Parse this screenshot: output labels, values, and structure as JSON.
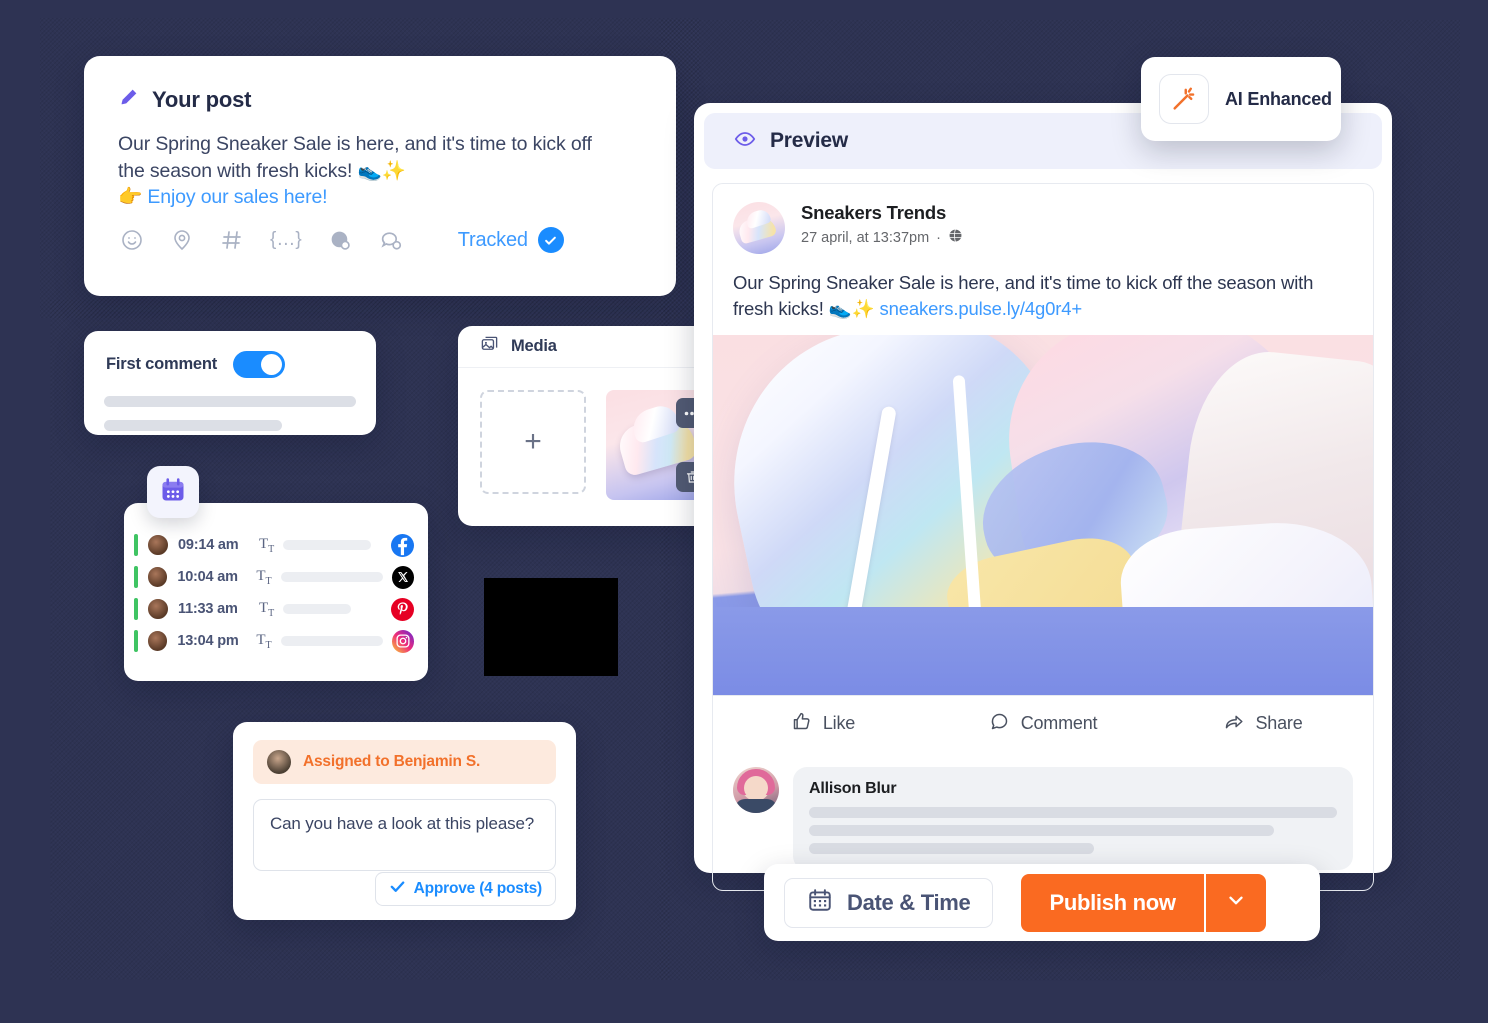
{
  "background_color": "#2e3353",
  "your_post": {
    "icon": "pencil-icon",
    "title": "Your post",
    "body_line1": "Our Spring Sneaker Sale is here, and it's time to kick off",
    "body_line2": "the season with fresh kicks! 👟✨",
    "link_line": "👉 Enjoy our sales here!",
    "tools": [
      {
        "name": "emoji-icon",
        "glyph": "emoji"
      },
      {
        "name": "location-icon",
        "glyph": "pin"
      },
      {
        "name": "hashtag-icon",
        "glyph": "#"
      },
      {
        "name": "variable-icon",
        "glyph": "{...}"
      },
      {
        "name": "globe-settings-icon",
        "glyph": "globe"
      },
      {
        "name": "chat-settings-icon",
        "glyph": "chat"
      }
    ],
    "tracked_label": "Tracked",
    "tracked_checked": true,
    "accent_blue": "#1a8cff"
  },
  "first_comment": {
    "label": "First comment",
    "toggle_on": true
  },
  "media": {
    "icon": "images-icon",
    "title": "Media",
    "add_label": "+",
    "thumb_more_icon": "more-dots-icon",
    "thumb_delete_icon": "trash-icon"
  },
  "schedule": {
    "badge_icon": "calendar-icon",
    "rows": [
      {
        "time": "09:14 am",
        "type_icon": "text-format-icon",
        "network": "facebook",
        "network_color": "#1877f2"
      },
      {
        "time": "10:04 am",
        "type_icon": "text-format-icon",
        "network": "x",
        "network_color": "#000000"
      },
      {
        "time": "11:33 am",
        "type_icon": "text-format-icon",
        "network": "pinterest",
        "network_color": "#e60023"
      },
      {
        "time": "13:04 pm",
        "type_icon": "text-format-icon",
        "network": "instagram",
        "network_color": "#e1306c"
      }
    ],
    "status_color": "#3fc463"
  },
  "approve": {
    "assigned_label": "Assigned to Benjamin S.",
    "assigned_color": "#f2712b",
    "note": "Can you have a look at this please?",
    "button_label": "Approve (4 posts)",
    "button_icon": "check-icon"
  },
  "preview": {
    "icon": "eye-icon",
    "title": "Preview",
    "post": {
      "author": "Sneakers Trends",
      "timestamp": "27 april, at 13:37pm",
      "separator": "·",
      "audience_icon": "globe-icon",
      "text": "Our Spring Sneaker Sale is here, and it's time to kick off the season with fresh kicks! 👟✨ ",
      "url": "sneakers.pulse.ly/4g0r4+",
      "image_alt": "pastel sneakers photo"
    },
    "actions": [
      {
        "name": "like-button",
        "label": "Like",
        "icon": "thumbs-up-icon"
      },
      {
        "name": "comment-button",
        "label": "Comment",
        "icon": "comment-bubble-icon"
      },
      {
        "name": "share-button",
        "label": "Share",
        "icon": "share-arrow-icon"
      }
    ],
    "comment": {
      "author": "Allison Blur"
    }
  },
  "ai_badge": {
    "icon": "magic-wand-icon",
    "label": "AI Enhanced",
    "icon_color": "#f2712b"
  },
  "action_bar": {
    "date_time_label": "Date & Time",
    "date_time_icon": "calendar-icon",
    "publish_label": "Publish now",
    "publish_caret_icon": "chevron-down-icon",
    "publish_color": "#fa6a21"
  }
}
